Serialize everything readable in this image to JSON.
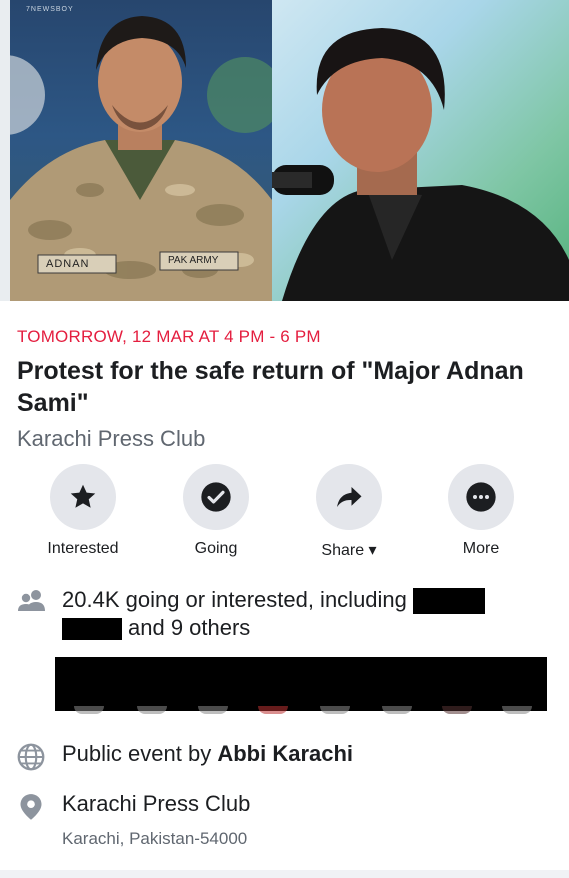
{
  "cover": {
    "caption": "7NEWSBOY",
    "left_name_tag": "ADNAN",
    "left_unit_tag": "PAK ARMY"
  },
  "event": {
    "date": "TOMORROW, 12 MAR AT 4 PM - 6 PM",
    "title": "Protest for the safe return of \"Major Adnan Sami\"",
    "venue": "Karachi Press Club"
  },
  "actions": [
    {
      "label": "Interested",
      "icon": "star-icon"
    },
    {
      "label": "Going",
      "icon": "check-circle-icon"
    },
    {
      "label": "Share ▾",
      "icon": "share-arrow-icon"
    },
    {
      "label": "More",
      "icon": "more-dots-icon"
    }
  ],
  "attendance": {
    "text_before": "20.4K going or interested, including",
    "text_after": "and 9 others"
  },
  "host": {
    "prefix": "Public event by",
    "name": "Abbi Karachi"
  },
  "location": {
    "name": "Karachi Press Club",
    "address": "Karachi, Pakistan-54000"
  },
  "colors": {
    "date_red": "#e41e3f",
    "action_circle": "#e4e6eb",
    "secondary_text": "#606770",
    "icon_gray": "#8d949e"
  }
}
